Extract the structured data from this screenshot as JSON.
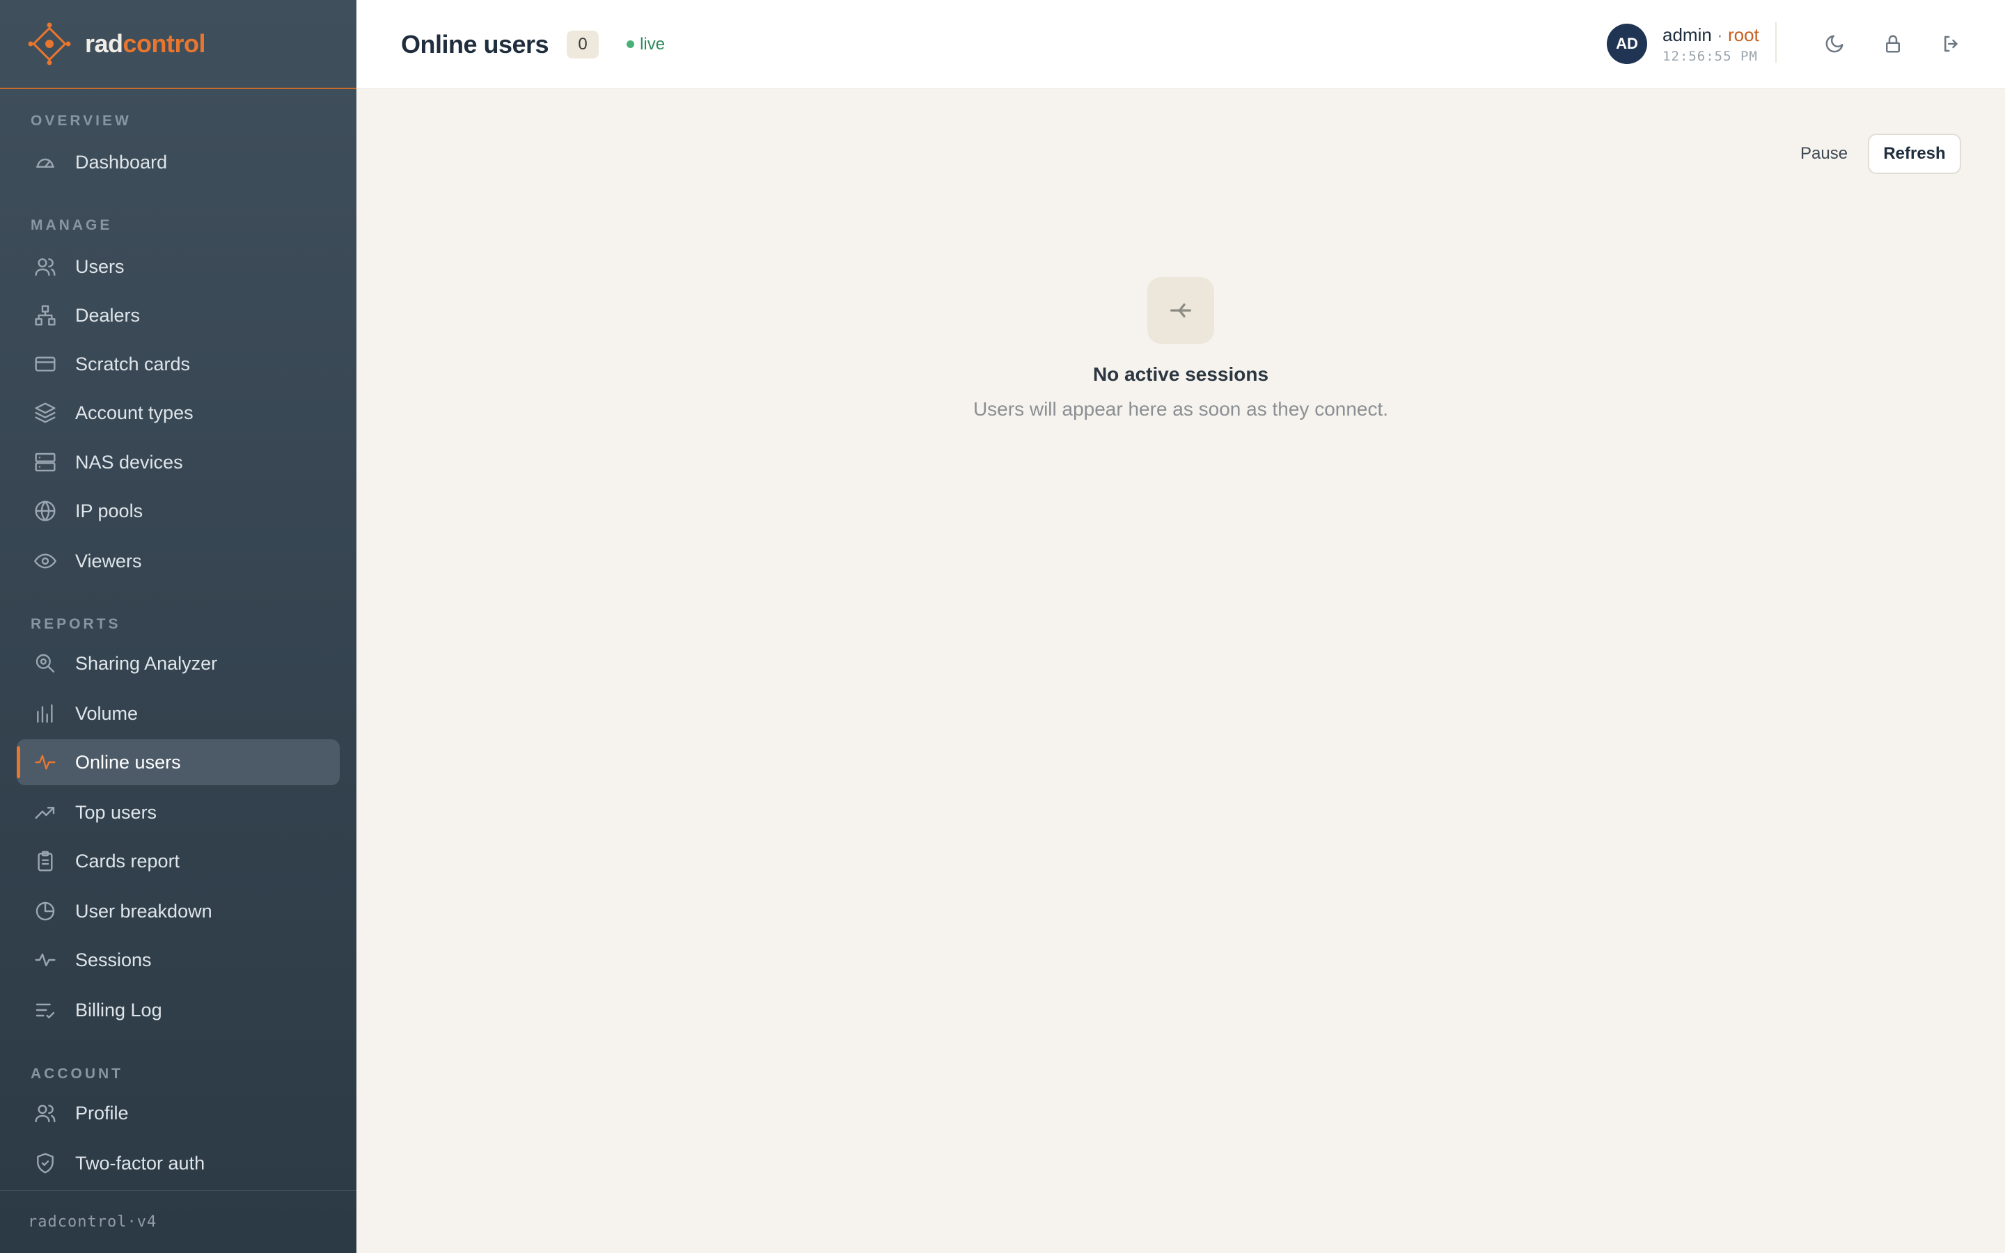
{
  "brand": {
    "name_part1": "rad",
    "name_part2": "control",
    "accent": "#e9762f"
  },
  "sidebar": {
    "sections": {
      "overview": "OVERVIEW",
      "manage": "MANAGE",
      "reports": "REPORTS",
      "account": "ACCOUNT"
    },
    "items": {
      "dashboard": "Dashboard",
      "users": "Users",
      "dealers": "Dealers",
      "scratch_cards": "Scratch cards",
      "account_types": "Account types",
      "nas_devices": "NAS devices",
      "ip_pools": "IP pools",
      "viewers": "Viewers",
      "sharing_analyzer": "Sharing Analyzer",
      "volume": "Volume",
      "online_users": "Online users",
      "top_users": "Top users",
      "cards_report": "Cards report",
      "user_breakdown": "User breakdown",
      "sessions": "Sessions",
      "billing_log": "Billing Log",
      "profile": "Profile",
      "two_factor": "Two-factor auth"
    },
    "active": "online_users",
    "footer": "radcontrol·v4"
  },
  "header": {
    "title": "Online users",
    "count": "0",
    "live_label": "live",
    "avatar_initials": "AD",
    "username": "admin",
    "separator": " · ",
    "role": "root",
    "time": "12:56:55 PM"
  },
  "toolbar": {
    "pause_label": "Pause",
    "refresh_label": "Refresh"
  },
  "empty_state": {
    "title": "No active sessions",
    "subtitle": "Users will appear here as soon as they connect."
  }
}
